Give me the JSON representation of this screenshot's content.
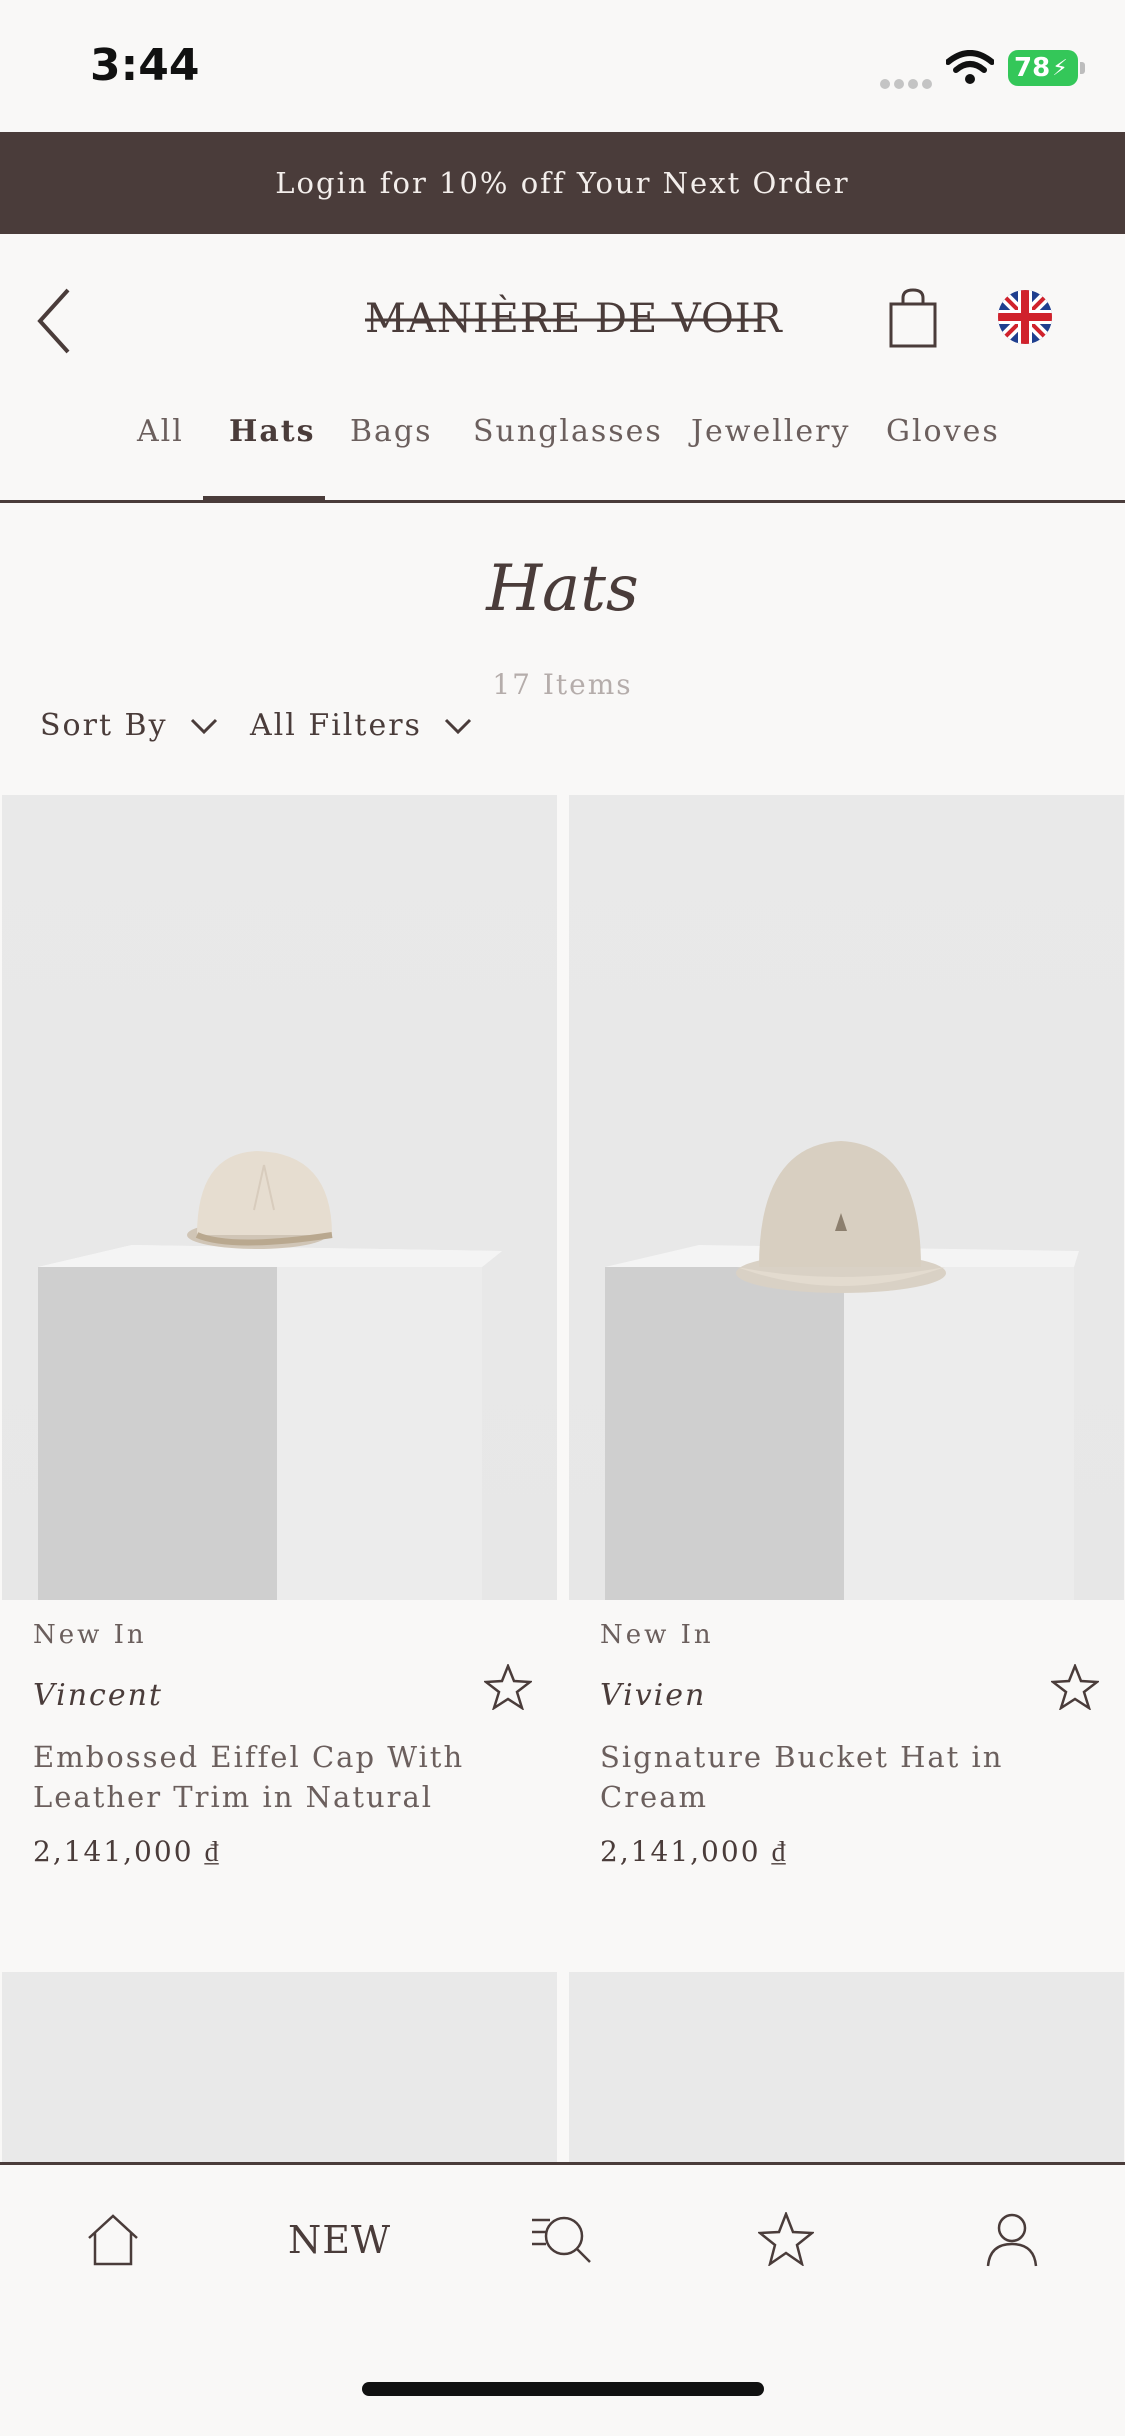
{
  "status_bar": {
    "time": "3:44",
    "battery": "78"
  },
  "promo": {
    "text": "Login for 10% off Your Next Order"
  },
  "header": {
    "brand": "MANIÈRE DE VOIR"
  },
  "tabs": [
    {
      "label": "All"
    },
    {
      "label": "Hats"
    },
    {
      "label": "Bags"
    },
    {
      "label": "Sunglasses"
    },
    {
      "label": "Jewellery"
    },
    {
      "label": "Gloves"
    }
  ],
  "active_tab": "Hats",
  "listing": {
    "title": "Hats",
    "count": "17 Items",
    "sort_label": "Sort By",
    "filter_label": "All Filters"
  },
  "products": [
    {
      "badge": "New In",
      "name": "Vincent",
      "description": "Embossed Eiffel Cap With Leather Trim in Natural",
      "price": "2,141,000 ₫"
    },
    {
      "badge": "New In",
      "name": "Vivien",
      "description": "Signature Bucket Hat in Cream",
      "price": "2,141,000 ₫"
    }
  ],
  "bottom_nav": {
    "new_label": "NEW"
  },
  "colors": {
    "brand": "#4a3c3a",
    "background": "#f9f8f7",
    "battery": "#34c759"
  }
}
